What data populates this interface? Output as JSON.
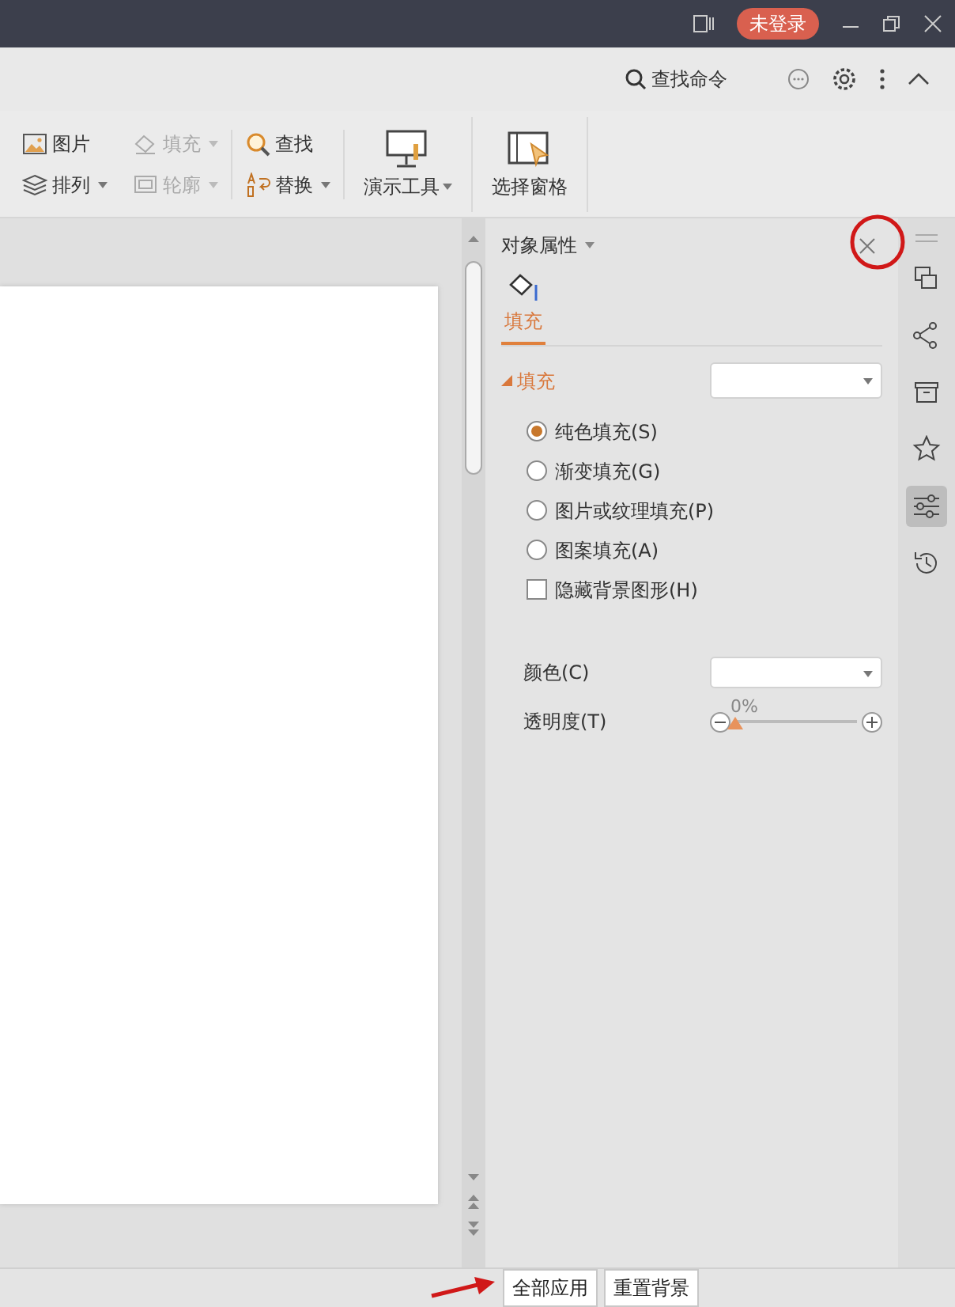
{
  "title_bar": {
    "login_badge": "未登录"
  },
  "toolbar": {
    "search_command": "查找命令"
  },
  "ribbon": {
    "small_groups": [
      [
        {
          "label": "图片",
          "disabled": false,
          "dropdown": false
        },
        {
          "label": "排列",
          "disabled": false,
          "dropdown": true
        }
      ],
      [
        {
          "label": "填充",
          "disabled": true,
          "dropdown": true
        },
        {
          "label": "轮廓",
          "disabled": true,
          "dropdown": true
        }
      ],
      [
        {
          "label": "查找",
          "disabled": false,
          "dropdown": false
        },
        {
          "label": "替换",
          "disabled": false,
          "dropdown": true
        }
      ]
    ],
    "large_buttons": [
      {
        "label": "演示工具",
        "dropdown": true
      },
      {
        "label": "选择窗格",
        "dropdown": false
      }
    ]
  },
  "panel": {
    "title": "对象属性",
    "tabs": [
      {
        "label": "填充",
        "selected": true
      }
    ],
    "section": {
      "label": "填充",
      "expanded": true
    },
    "fill_options": [
      {
        "kind": "radio",
        "label": "纯色填充(S)",
        "selected": true
      },
      {
        "kind": "radio",
        "label": "渐变填充(G)",
        "selected": false
      },
      {
        "kind": "radio",
        "label": "图片或纹理填充(P)",
        "selected": false
      },
      {
        "kind": "radio",
        "label": "图案填充(A)",
        "selected": false
      },
      {
        "kind": "checkbox",
        "label": "隐藏背景图形(H)",
        "checked": false
      }
    ],
    "color_label": "颜色(C)",
    "transparency": {
      "label": "透明度(T)",
      "reading": "0%",
      "level": 0
    },
    "buttons": [
      "全部应用",
      "重置背景"
    ]
  },
  "side_tools": [
    {
      "selected": false
    },
    {
      "selected": false
    },
    {
      "selected": false
    },
    {
      "selected": false
    },
    {
      "selected": true
    },
    {
      "selected": false
    }
  ]
}
